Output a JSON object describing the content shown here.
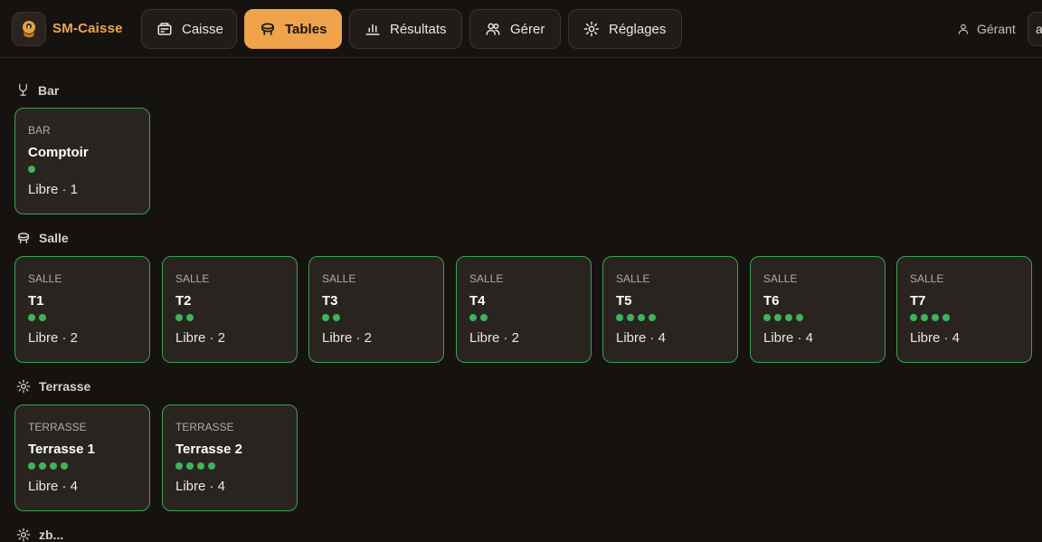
{
  "app": {
    "name": "SM-Caisse"
  },
  "nav": [
    {
      "label": "Caisse",
      "icon": "register-icon"
    },
    {
      "label": "Tables",
      "icon": "table-icon",
      "active": true
    },
    {
      "label": "Résultats",
      "icon": "bar-chart-icon"
    },
    {
      "label": "Gérer",
      "icon": "users-icon"
    },
    {
      "label": "Réglages",
      "icon": "sun-settings-icon"
    }
  ],
  "user": {
    "label": "Gérant",
    "button_label": "a"
  },
  "colors": {
    "accent": "#efa34a",
    "free": "#3fb45a",
    "card_border": "#3aa24f"
  },
  "sections": [
    {
      "title": "Bar",
      "icon": "glass-icon",
      "tables": [
        {
          "zone": "BAR",
          "name": "Comptoir",
          "seats": 1,
          "status": "Libre · 1"
        }
      ]
    },
    {
      "title": "Salle",
      "icon": "table-icon",
      "tables": [
        {
          "zone": "SALLE",
          "name": "T1",
          "seats": 2,
          "status": "Libre · 2"
        },
        {
          "zone": "SALLE",
          "name": "T2",
          "seats": 2,
          "status": "Libre · 2"
        },
        {
          "zone": "SALLE",
          "name": "T3",
          "seats": 2,
          "status": "Libre · 2"
        },
        {
          "zone": "SALLE",
          "name": "T4",
          "seats": 2,
          "status": "Libre · 2"
        },
        {
          "zone": "SALLE",
          "name": "T5",
          "seats": 4,
          "status": "Libre · 4"
        },
        {
          "zone": "SALLE",
          "name": "T6",
          "seats": 4,
          "status": "Libre · 4"
        },
        {
          "zone": "SALLE",
          "name": "T7",
          "seats": 4,
          "status": "Libre · 4"
        }
      ]
    },
    {
      "title": "Terrasse",
      "icon": "sun-icon",
      "tables": [
        {
          "zone": "TERRASSE",
          "name": "Terrasse 1",
          "seats": 4,
          "status": "Libre · 4"
        },
        {
          "zone": "TERRASSE",
          "name": "Terrasse 2",
          "seats": 4,
          "status": "Libre · 4"
        }
      ]
    },
    {
      "title": "zb...",
      "icon": "sun-icon",
      "tables": []
    }
  ]
}
